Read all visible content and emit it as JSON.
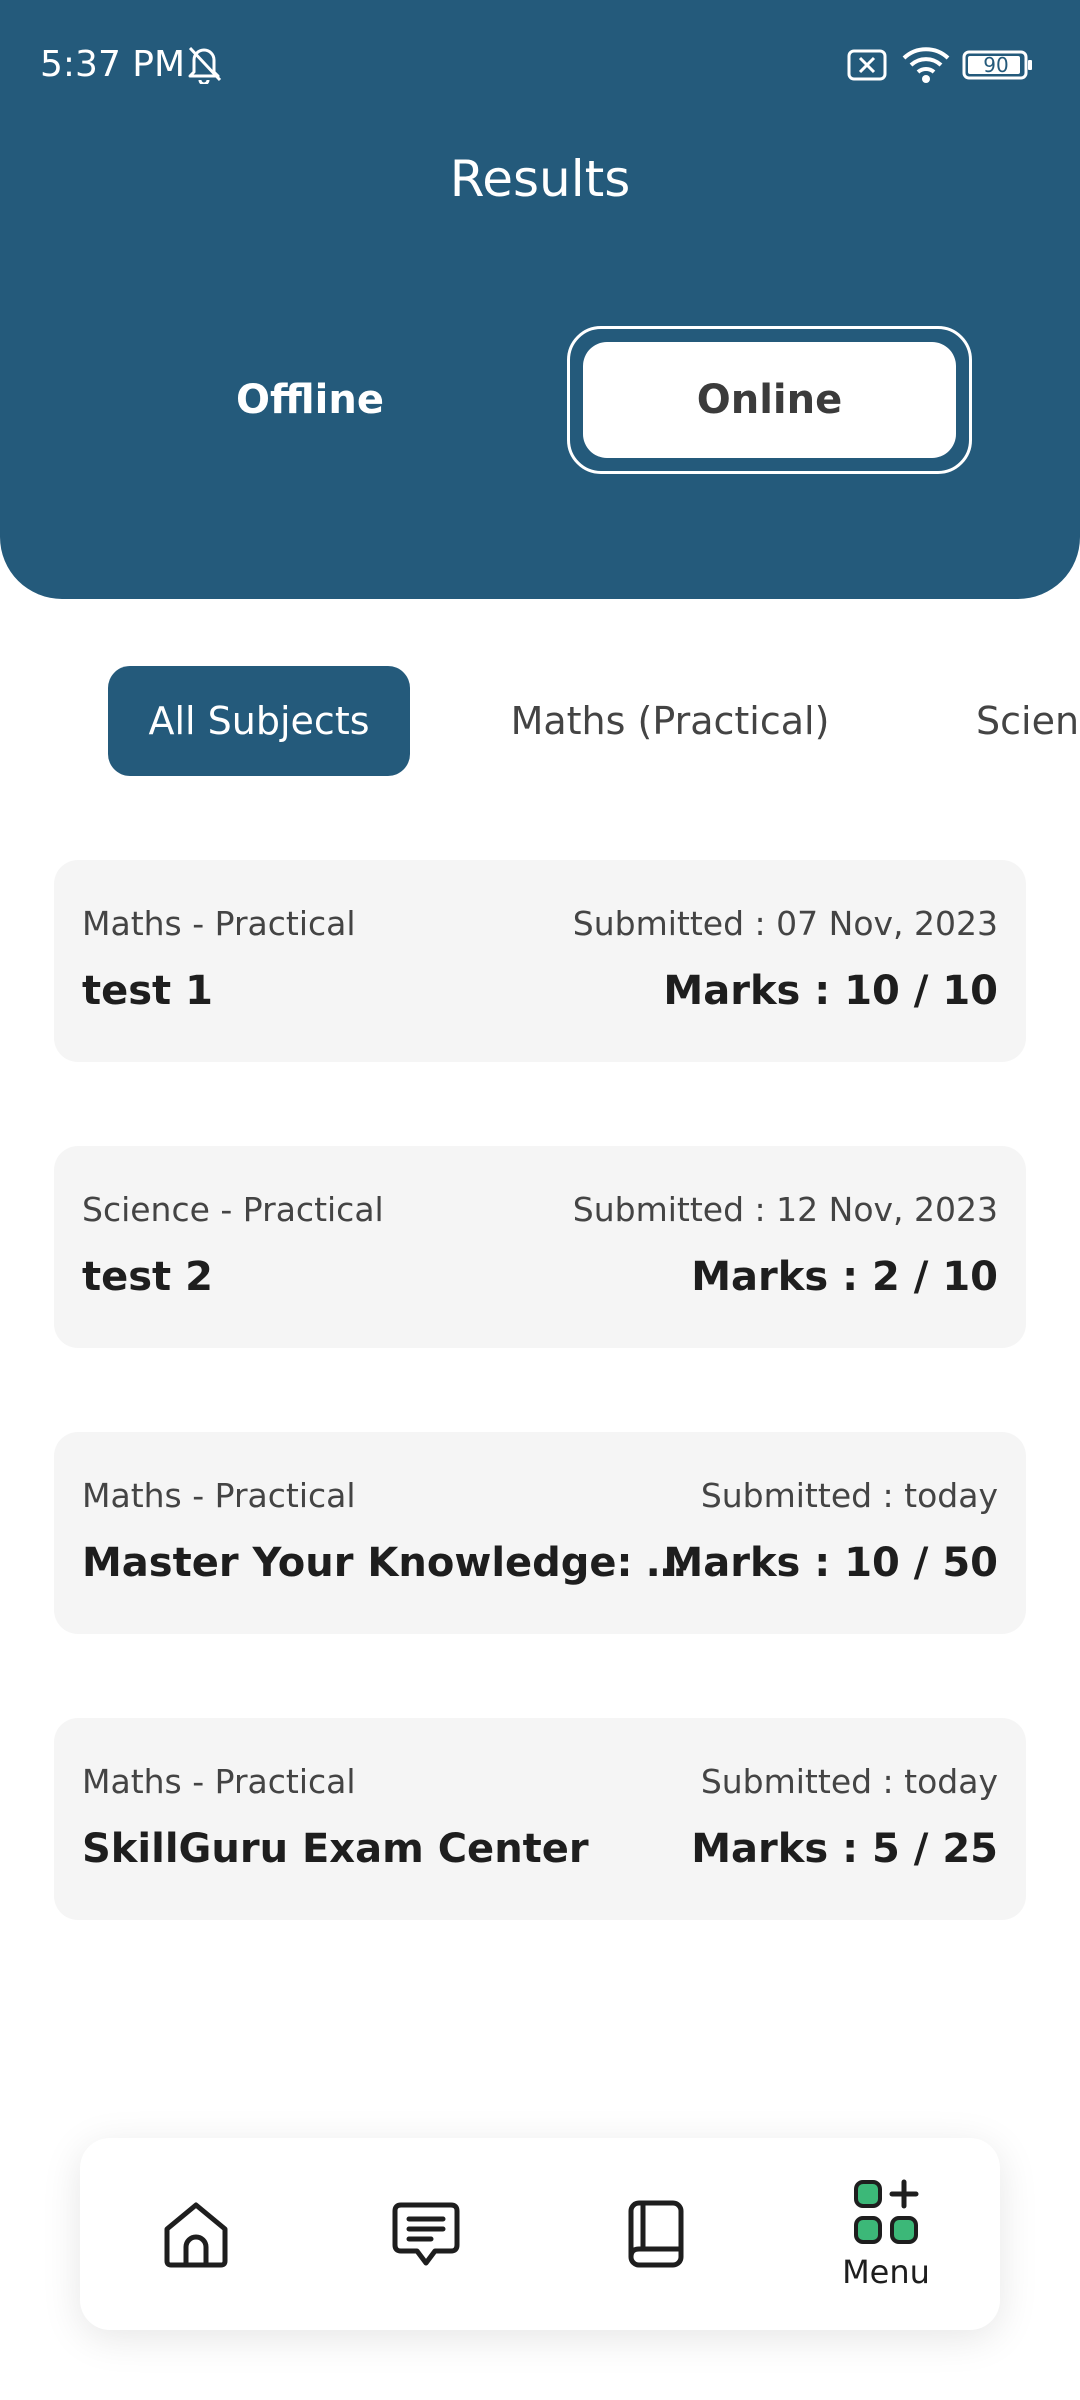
{
  "status_bar": {
    "time": "5:37 PM",
    "battery": "90"
  },
  "header": {
    "title": "Results",
    "segments": [
      {
        "label": "Offline",
        "active": false
      },
      {
        "label": "Online",
        "active": true
      }
    ]
  },
  "filters": {
    "chips": [
      {
        "label": "All Subjects",
        "active": true
      },
      {
        "label": "Maths (Practical)",
        "active": false
      },
      {
        "label": "Science (Practical)",
        "active": false
      }
    ]
  },
  "results": [
    {
      "subject": "Maths - Practical",
      "submitted": "Submitted : 07 Nov, 2023",
      "title": "test 1",
      "marks": "Marks : 10 / 10"
    },
    {
      "subject": "Science - Practical",
      "submitted": "Submitted : 12 Nov, 2023",
      "title": "test 2",
      "marks": "Marks : 2 / 10"
    },
    {
      "subject": "Maths - Practical",
      "submitted": "Submitted : today",
      "title": "Master Your Knowledge: Online Exam",
      "marks": "Marks : 10 / 50"
    },
    {
      "subject": "Maths - Practical",
      "submitted": "Submitted : today",
      "title": "SkillGuru Exam Center",
      "marks": "Marks : 5 / 25"
    }
  ],
  "bottom_nav": {
    "items": [
      {
        "icon": "home-icon"
      },
      {
        "icon": "chat-icon"
      },
      {
        "icon": "book-icon"
      },
      {
        "icon": "menu-grid-icon",
        "label": "Menu"
      }
    ]
  },
  "colors": {
    "primary": "#245a7b",
    "card_bg": "#f5f5f5",
    "menu_accent": "#3cb878"
  }
}
